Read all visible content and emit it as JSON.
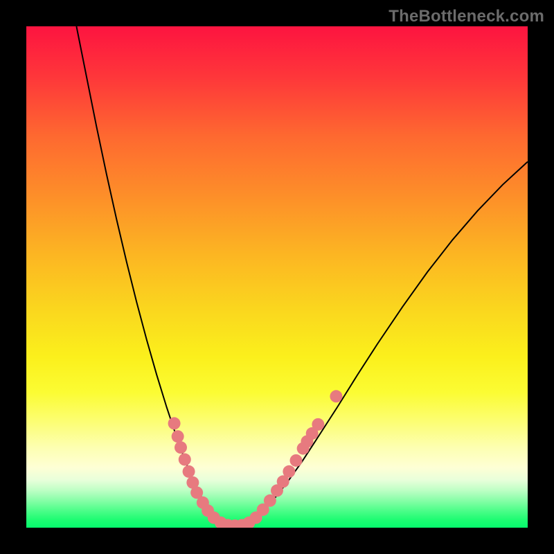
{
  "attribution": "TheBottleneck.com",
  "chart_data": {
    "type": "line",
    "title": "",
    "xlabel": "",
    "ylabel": "",
    "xlim": [
      0,
      100
    ],
    "ylim": [
      0,
      100
    ],
    "curve_left": {
      "x": [
        10,
        12,
        14,
        16,
        18,
        20,
        22,
        24,
        26,
        28,
        30,
        31,
        32,
        33,
        34,
        35,
        36,
        37,
        38
      ],
      "y": [
        100,
        90,
        80,
        70.5,
        61.5,
        53,
        45,
        37.5,
        30.5,
        24,
        18,
        15.2,
        12.6,
        10.2,
        8.0,
        6.0,
        4.2,
        2.6,
        1.2
      ]
    },
    "curve_flat": {
      "x": [
        38,
        39,
        40,
        41,
        42,
        43,
        44,
        45
      ],
      "y": [
        1.2,
        0.6,
        0.3,
        0.2,
        0.2,
        0.3,
        0.6,
        1.2
      ]
    },
    "curve_right": {
      "x": [
        45,
        47,
        49,
        52,
        55,
        58,
        62,
        66,
        70,
        75,
        80,
        85,
        90,
        95,
        100
      ],
      "y": [
        1.2,
        3.0,
        5.2,
        9.0,
        13.2,
        17.8,
        24.0,
        30.4,
        36.6,
        44.0,
        51.0,
        57.4,
        63.2,
        68.4,
        73.0
      ]
    },
    "dot_clusters": [
      {
        "x": 29.5,
        "y": 20.8
      },
      {
        "x": 30.2,
        "y": 18.2
      },
      {
        "x": 30.8,
        "y": 16.0
      },
      {
        "x": 31.6,
        "y": 13.6
      },
      {
        "x": 32.4,
        "y": 11.2
      },
      {
        "x": 33.2,
        "y": 9.0
      },
      {
        "x": 34.0,
        "y": 7.0
      },
      {
        "x": 35.2,
        "y": 5.0
      },
      {
        "x": 36.2,
        "y": 3.4
      },
      {
        "x": 37.4,
        "y": 2.0
      },
      {
        "x": 38.8,
        "y": 1.0
      },
      {
        "x": 40.2,
        "y": 0.5
      },
      {
        "x": 41.6,
        "y": 0.4
      },
      {
        "x": 43.0,
        "y": 0.5
      },
      {
        "x": 44.4,
        "y": 1.0
      },
      {
        "x": 45.8,
        "y": 2.0
      },
      {
        "x": 47.2,
        "y": 3.6
      },
      {
        "x": 48.6,
        "y": 5.4
      },
      {
        "x": 50.0,
        "y": 7.4
      },
      {
        "x": 51.2,
        "y": 9.2
      },
      {
        "x": 52.4,
        "y": 11.2
      },
      {
        "x": 53.8,
        "y": 13.4
      },
      {
        "x": 55.2,
        "y": 15.8
      },
      {
        "x": 56.0,
        "y": 17.2
      },
      {
        "x": 57.0,
        "y": 18.8
      },
      {
        "x": 58.2,
        "y": 20.6
      },
      {
        "x": 61.8,
        "y": 26.2
      }
    ],
    "dot_color": "#e77a7f",
    "curve_color": "#000000"
  }
}
